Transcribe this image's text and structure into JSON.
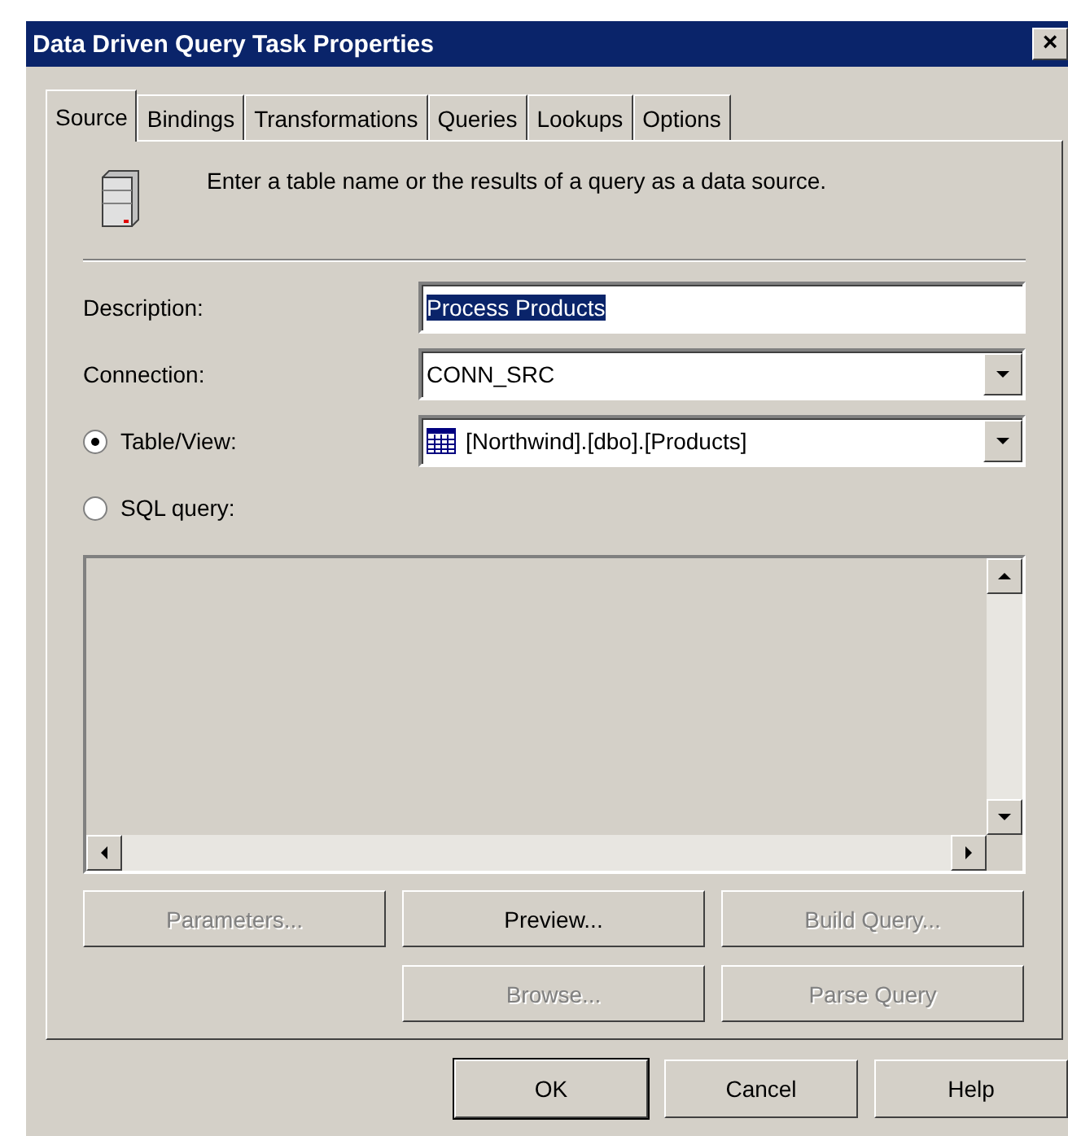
{
  "window": {
    "title": "Data Driven Query Task Properties",
    "close": "×"
  },
  "tabs": [
    {
      "label": "Source",
      "selected": true
    },
    {
      "label": "Bindings",
      "selected": false
    },
    {
      "label": "Transformations",
      "selected": false
    },
    {
      "label": "Queries",
      "selected": false
    },
    {
      "label": "Lookups",
      "selected": false
    },
    {
      "label": "Options",
      "selected": false
    }
  ],
  "intro": "Enter a table name or the results of a query as a data source.",
  "description": {
    "label": "Description:",
    "value": "Process Products"
  },
  "connection": {
    "label": "Connection:",
    "value": "CONN_SRC"
  },
  "sources": [
    {
      "label": "Table/View:",
      "selected": true
    },
    {
      "label": "SQL query:",
      "selected": false
    }
  ],
  "table_view": {
    "value": "[Northwind].[dbo].[Products]"
  },
  "query_buttons": [
    {
      "label": "Parameters...",
      "disabled": true
    },
    {
      "label": "Preview...",
      "disabled": false
    },
    {
      "label": "Build Query...",
      "disabled": true
    },
    {
      "label": "Browse...",
      "disabled": true
    },
    {
      "label": "Parse Query",
      "disabled": true
    }
  ],
  "dialog_buttons": [
    {
      "label": "OK",
      "default": true
    },
    {
      "label": "Cancel",
      "default": false
    },
    {
      "label": "Help",
      "default": false
    }
  ]
}
